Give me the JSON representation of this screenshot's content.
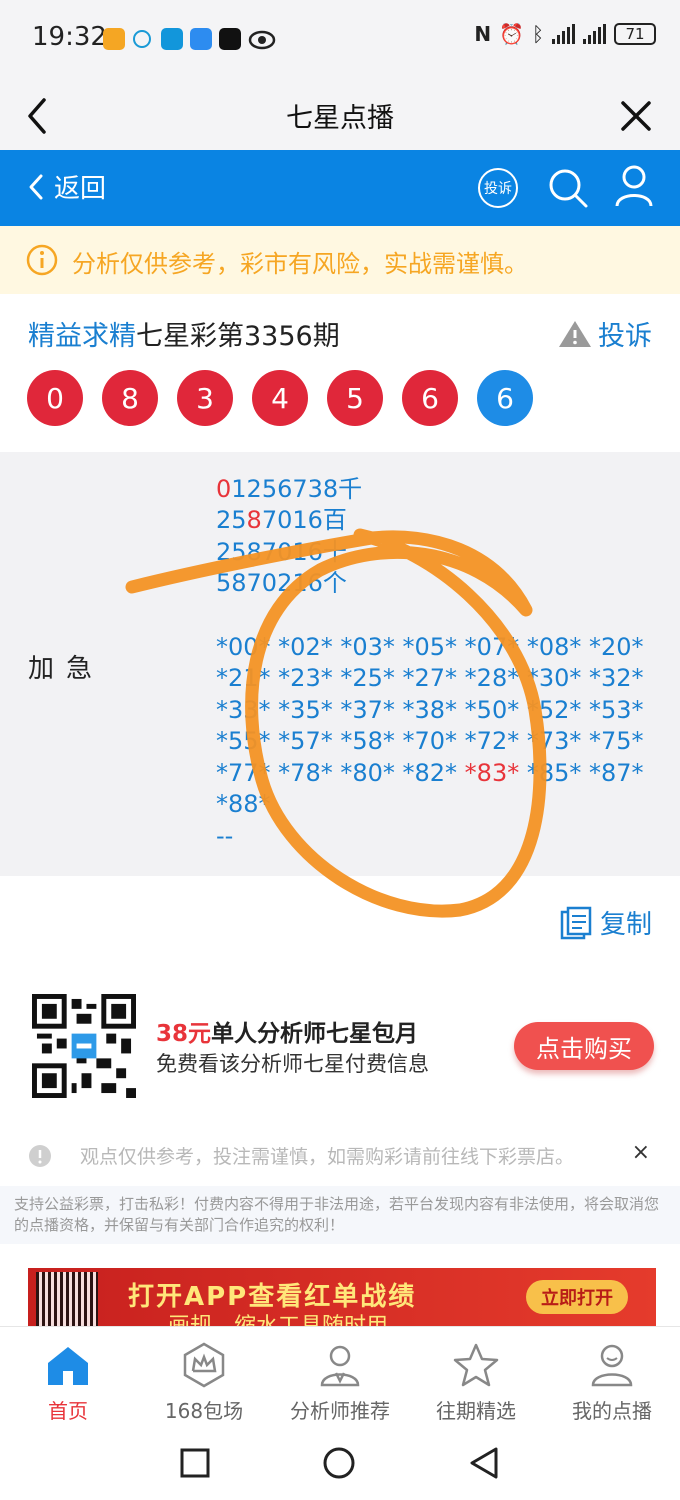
{
  "status_bar": {
    "time": "19:32",
    "battery": "71"
  },
  "title_bar": {
    "title": "七星点播"
  },
  "nav": {
    "back_label": "返回",
    "complain_icon_label": "投诉"
  },
  "notice": {
    "text": "分析仅供参考，彩市有风险，实战需谨慎。"
  },
  "header": {
    "title_highlight": "精益求精",
    "title_rest": "七星彩第3356期",
    "complain_label": "投诉"
  },
  "balls": [
    {
      "num": "0",
      "color": "#e0273a"
    },
    {
      "num": "8",
      "color": "#e0273a"
    },
    {
      "num": "3",
      "color": "#e0273a"
    },
    {
      "num": "4",
      "color": "#e0273a"
    },
    {
      "num": "5",
      "color": "#e0273a"
    },
    {
      "num": "6",
      "color": "#e0273a"
    },
    {
      "num": "6",
      "color": "#1e8ce6"
    }
  ],
  "content": {
    "label": "加急",
    "digit_lines": [
      {
        "red": "0",
        "rest": "1256738千"
      },
      {
        "pre": "25",
        "red": "8",
        "rest": "7016百"
      },
      {
        "text": "2587016十"
      },
      {
        "text": "5870216个"
      }
    ],
    "pair_lines": [
      "*00* *02* *03* *05* *07* *08* *20*",
      "*21* *23* *25* *27* *28* *30* *32*",
      "*33* *35* *37* *38* *50* *52* *53*",
      "*55* *57* *58* *70* *72* *73* *75*",
      "*77* *78* *80* *82* ",
      "*88*",
      "--"
    ],
    "pair_red": "*83*",
    "pair_after_red": " *85* *87*",
    "copy_label": "复制"
  },
  "promo": {
    "price": "38元",
    "title_rest": "单人分析师七星包月",
    "subtitle": "免费看该分析师七星付费信息",
    "buy_label": "点击购买"
  },
  "tip": {
    "text": "观点仅供参考，投注需谨慎，如需购彩请前往线下彩票店。",
    "close": "×"
  },
  "legal": {
    "text": "支持公益彩票，打击私彩！付费内容不得用于非法用途，若平台发现内容有非法使用，将会取消您的点播资格，并保留与有关部门合作追究的权利！"
  },
  "banner": {
    "title": "打开APP查看红单战绩",
    "subtitle": "画规、缩水工具随时用",
    "button": "立即打开"
  },
  "tabs": [
    {
      "label": "首页",
      "active": true
    },
    {
      "label": "168包场",
      "active": false
    },
    {
      "label": "分析师推荐",
      "active": false
    },
    {
      "label": "往期精选",
      "active": false
    },
    {
      "label": "我的点播",
      "active": false
    }
  ],
  "colors": {
    "primary_blue": "#0a84e3",
    "accent_red": "#e8343a",
    "annotation_orange": "#f39224"
  }
}
